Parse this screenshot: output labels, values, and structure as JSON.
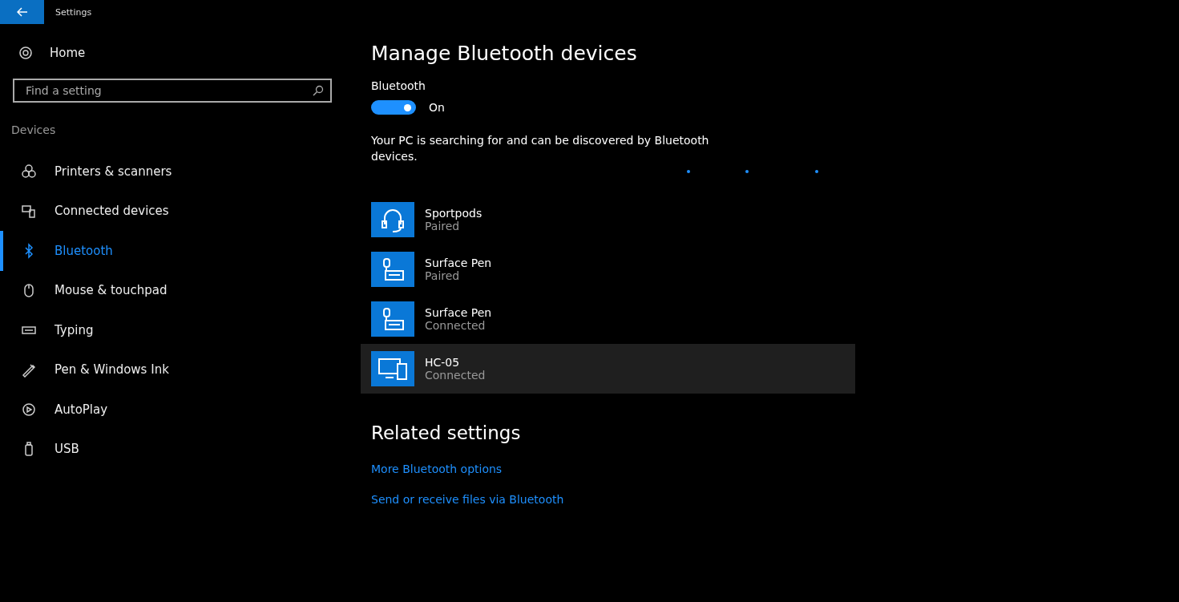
{
  "window": {
    "title": "Settings"
  },
  "sidebar": {
    "home": "Home",
    "search": {
      "placeholder": "Find a setting"
    },
    "section": "Devices",
    "items": [
      {
        "label": "Printers & scanners",
        "selected": false
      },
      {
        "label": "Connected devices",
        "selected": false
      },
      {
        "label": "Bluetooth",
        "selected": true
      },
      {
        "label": "Mouse & touchpad",
        "selected": false
      },
      {
        "label": "Typing",
        "selected": false
      },
      {
        "label": "Pen & Windows Ink",
        "selected": false
      },
      {
        "label": "AutoPlay",
        "selected": false
      },
      {
        "label": "USB",
        "selected": false
      }
    ]
  },
  "main": {
    "title": "Manage Bluetooth devices",
    "bluetooth": {
      "label": "Bluetooth",
      "on": true,
      "state": "On"
    },
    "description": "Your PC is searching for and can be discovered by Bluetooth devices.",
    "devices": [
      {
        "kind": "headset",
        "name": "Sportpods",
        "status": "Paired",
        "selected": false
      },
      {
        "kind": "pen",
        "name": "Surface Pen",
        "status": "Paired",
        "selected": false
      },
      {
        "kind": "pen",
        "name": "Surface Pen",
        "status": "Connected",
        "selected": false
      },
      {
        "kind": "display",
        "name": "HC-05",
        "status": "Connected",
        "selected": true
      }
    ],
    "related": {
      "title": "Related settings",
      "links": [
        "More Bluetooth options",
        "Send or receive files via Bluetooth"
      ]
    }
  }
}
